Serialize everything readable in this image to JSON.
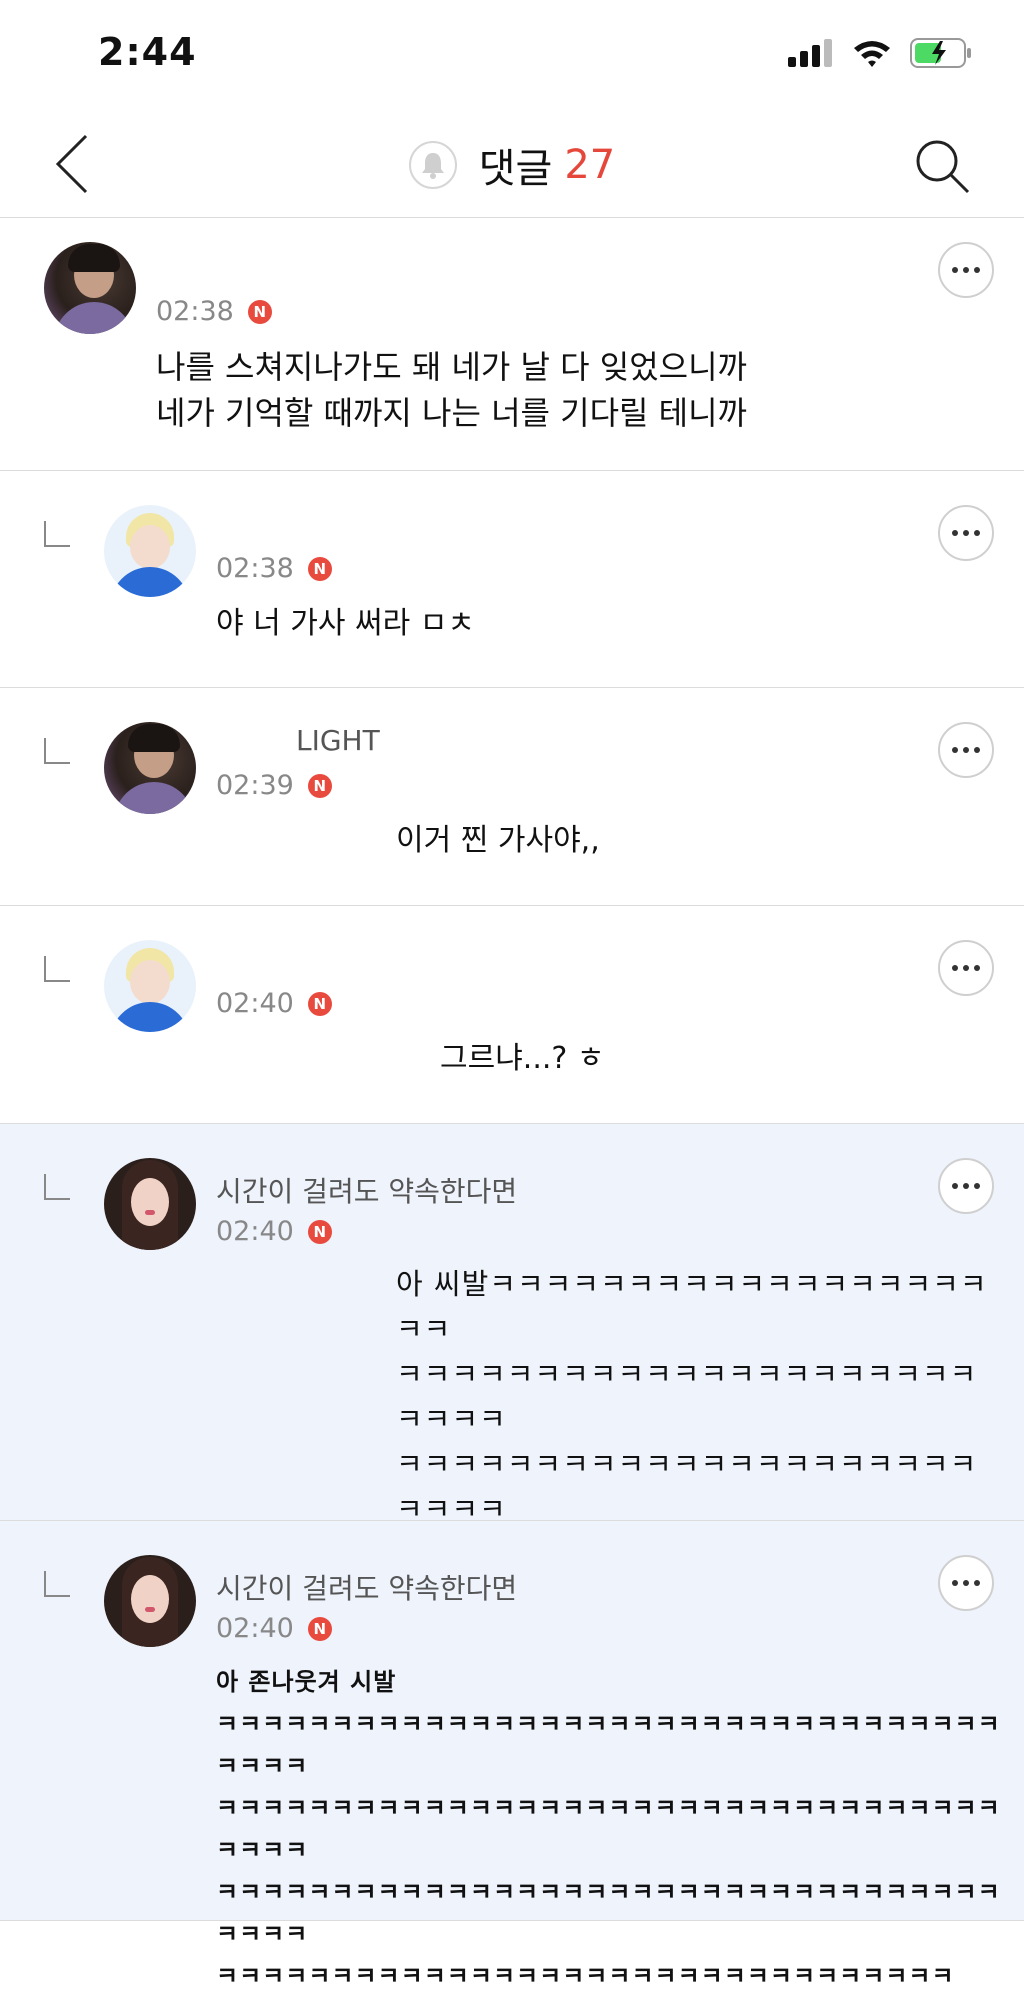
{
  "status": {
    "time": "2:44"
  },
  "nav": {
    "title": "댓글",
    "count": "27"
  },
  "comments": [
    {
      "name": "",
      "time": "02:38",
      "badge": "N",
      "text": "나를 스쳐지나가도 돼 네가 날 다 잊었으니까\n네가 기억할 때까지 나는 너를 기다릴 테니까"
    },
    {
      "name": "",
      "time": "02:38",
      "badge": "N",
      "text": "야 너 가사 써라 ㅁㅊ"
    },
    {
      "name": "LIGHT",
      "time": "02:39",
      "badge": "N",
      "text": "이거 찐 가사야,,"
    },
    {
      "name": "",
      "time": "02:40",
      "badge": "N",
      "text": "그르냐...? ㅎ"
    },
    {
      "name": "시간이 걸려도 약속한다면",
      "time": "02:40",
      "badge": "N",
      "text": "아 씨발ㅋㅋㅋㅋㅋㅋㅋㅋㅋㅋㅋㅋㅋㅋㅋㅋㅋㅋㅋㅋ\nㅋㅋㅋㅋㅋㅋㅋㅋㅋㅋㅋㅋㅋㅋㅋㅋㅋㅋㅋㅋㅋㅋㅋㅋㅋ\nㅋㅋㅋㅋㅋㅋㅋㅋㅋㅋㅋㅋㅋㅋㅋㅋㅋㅋㅋㅋㅋㅋㅋㅋㅋ\nㅋㅋㅋㅋㅋㅋㅋㅋㅋㅋㅋㅋㅋㅋㅋㅋㅋㅋㅋㅋㅋㅋㅋㅋㅋ\nㅋㅋㅋㅋㅋㅋㅋㅋㅋㅋㅋㅋㅋㅋㅋㅋㅋㅋㅋㅋㅋㅋㅋ"
    },
    {
      "name": "시간이 걸려도 약속한다면",
      "time": "02:40",
      "badge": "N",
      "text": "아 존나웃겨 시발\nㅋㅋㅋㅋㅋㅋㅋㅋㅋㅋㅋㅋㅋㅋㅋㅋㅋㅋㅋㅋㅋㅋㅋㅋㅋㅋㅋㅋㅋㅋㅋㅋㅋㅋㅋㅋㅋㅋ\nㅋㅋㅋㅋㅋㅋㅋㅋㅋㅋㅋㅋㅋㅋㅋㅋㅋㅋㅋㅋㅋㅋㅋㅋㅋㅋㅋㅋㅋㅋㅋㅋㅋㅋㅋㅋㅋㅋ\nㅋㅋㅋㅋㅋㅋㅋㅋㅋㅋㅋㅋㅋㅋㅋㅋㅋㅋㅋㅋㅋㅋㅋㅋㅋㅋㅋㅋㅋㅋㅋㅋㅋㅋㅋㅋㅋㅋ\nㅋㅋㅋㅋㅋㅋㅋㅋㅋㅋㅋㅋㅋㅋㅋㅋㅋㅋㅋㅋㅋㅋㅋㅋㅋㅋㅋㅋㅋㅋㅋㅋ"
    }
  ],
  "colors": {
    "accent": "#e5483a",
    "highlight_bg": "#eef3fc",
    "battery": "#4cd964"
  }
}
